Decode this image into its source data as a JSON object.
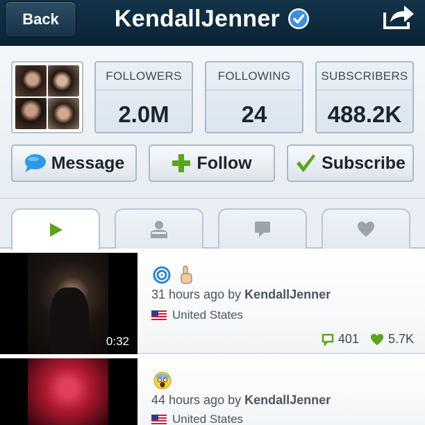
{
  "header": {
    "back_label": "Back",
    "title": "KendallJenner"
  },
  "stats": [
    {
      "label": "FOLLOWERS",
      "value": "2.0M"
    },
    {
      "label": "FOLLOWING",
      "value": "24"
    },
    {
      "label": "SUBSCRIBERS",
      "value": "488.2K"
    }
  ],
  "actions": {
    "message_label": "Message",
    "follow_label": "Follow",
    "subscribe_label": "Subscribe"
  },
  "tabs": [
    {
      "icon": "play-icon",
      "active": true
    },
    {
      "icon": "person-icon",
      "active": false
    },
    {
      "icon": "comment-icon",
      "active": false
    },
    {
      "icon": "heart-icon",
      "active": false
    }
  ],
  "posts": [
    {
      "emojis": [
        "cyclone-emoji",
        "pointing-up-emoji"
      ],
      "time_prefix": "31 hours ago by",
      "author": "KendallJenner",
      "location": "United States",
      "duration": "0:32",
      "comments": "401",
      "likes": "5.7K"
    },
    {
      "emojis": [
        "screaming-face-emoji"
      ],
      "time_prefix": "44 hours ago by",
      "author": "KendallJenner",
      "location": "United States"
    }
  ],
  "colors": {
    "header_bg": "#0f2c40",
    "verified_blue": "#3a8fe0",
    "accent_green": "#5aa51b",
    "message_blue": "#2b9be6"
  }
}
